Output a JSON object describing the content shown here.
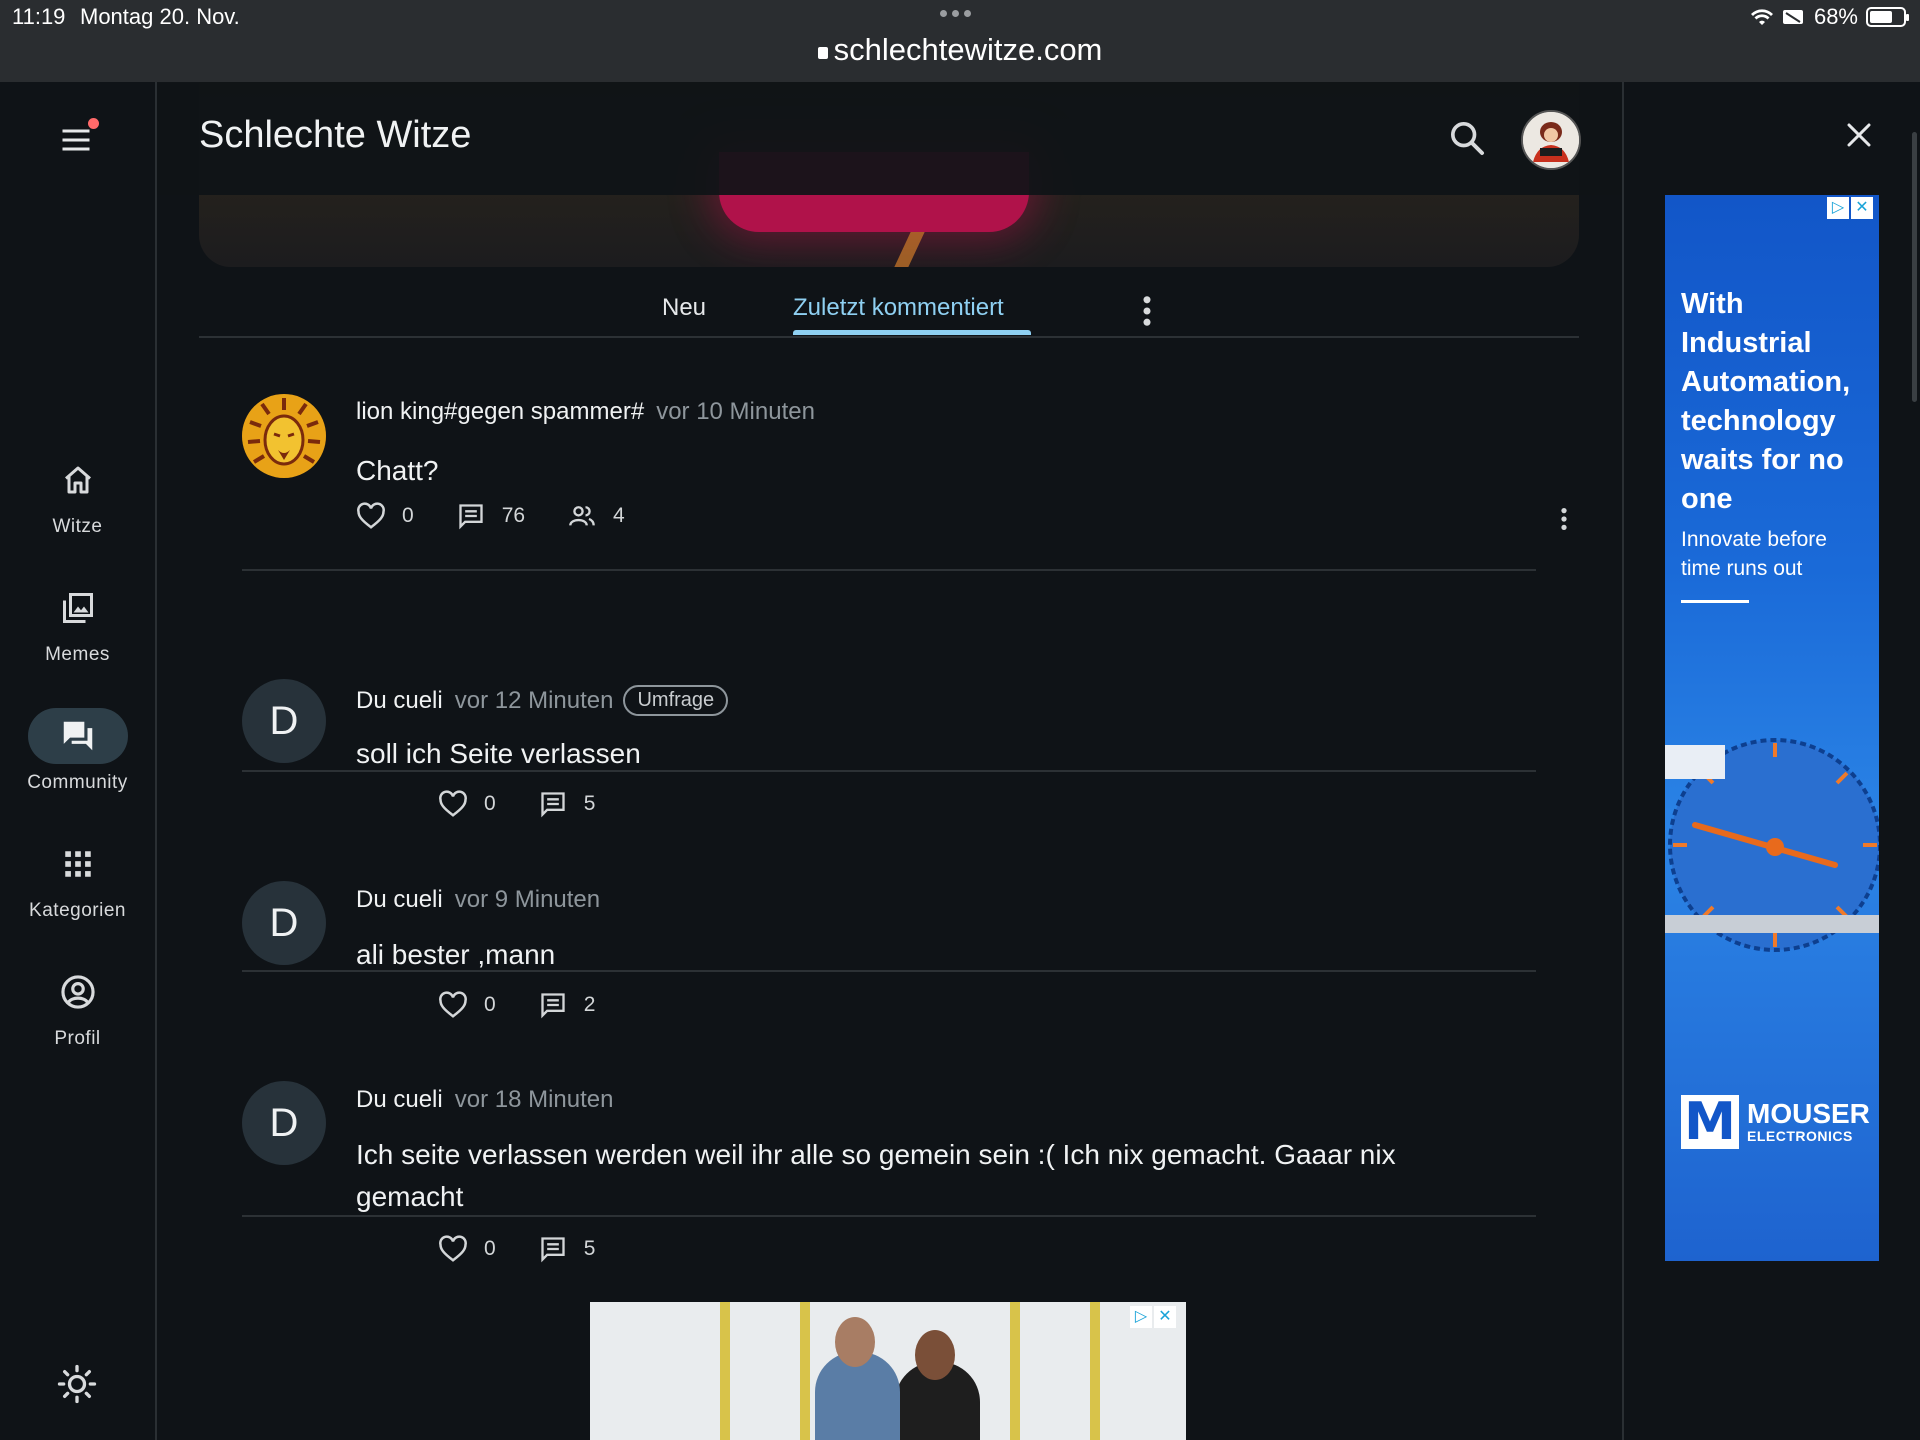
{
  "statusbar": {
    "time": "11:19",
    "date": "Montag 20. Nov.",
    "url": "schlechtewitze.com",
    "battery": "68%",
    "battery_level": 0.68
  },
  "rail": {
    "items": [
      {
        "label": "Witze",
        "icon": "home-icon"
      },
      {
        "label": "Memes",
        "icon": "images-icon"
      },
      {
        "label": "Community",
        "icon": "forum-icon"
      },
      {
        "label": "Kategorien",
        "icon": "grid-icon"
      },
      {
        "label": "Profil",
        "icon": "account-circle-icon"
      }
    ],
    "active": "Community"
  },
  "header": {
    "title": "Schlechte Witze"
  },
  "tabs": {
    "new": "Neu",
    "recent": "Zuletzt kommentiert",
    "active": "Zuletzt kommentiert"
  },
  "posts": [
    {
      "author": "lion king#gegen spammer#",
      "time": "vor 10 Minuten",
      "avatar": "lion-logo",
      "text": "Chatt?",
      "likes": "0",
      "comments": "76",
      "participants": "4"
    },
    {
      "author": "Du cueli",
      "time": "vor 12 Minuten",
      "badge": "Umfrage",
      "avatar": "D",
      "text": "soll ich Seite verlassen",
      "likes": "0",
      "comments": "5"
    },
    {
      "author": "Du cueli",
      "time": "vor 9 Minuten",
      "avatar": "D",
      "text": "ali bester ,mann",
      "likes": "0",
      "comments": "2"
    },
    {
      "author": "Du cueli",
      "time": "vor 18 Minuten",
      "avatar": "D",
      "text": "Ich seite verlassen werden weil ihr alle so gemein sein :( Ich nix gemacht. Gaaar nix gemacht",
      "likes": "0",
      "comments": "5"
    }
  ],
  "side_ad": {
    "headline": "With Industrial Automation, technology waits for no one",
    "subline": "Innovate before time runs out",
    "brand": "MOUSER",
    "brand_sub": "ELECTRONICS",
    "logo_letter": "M",
    "color": "#1a6ad8"
  },
  "colors": {
    "background": "#0f1317",
    "accent": "#8fd0f2",
    "nav_active": "#2d3e48"
  }
}
